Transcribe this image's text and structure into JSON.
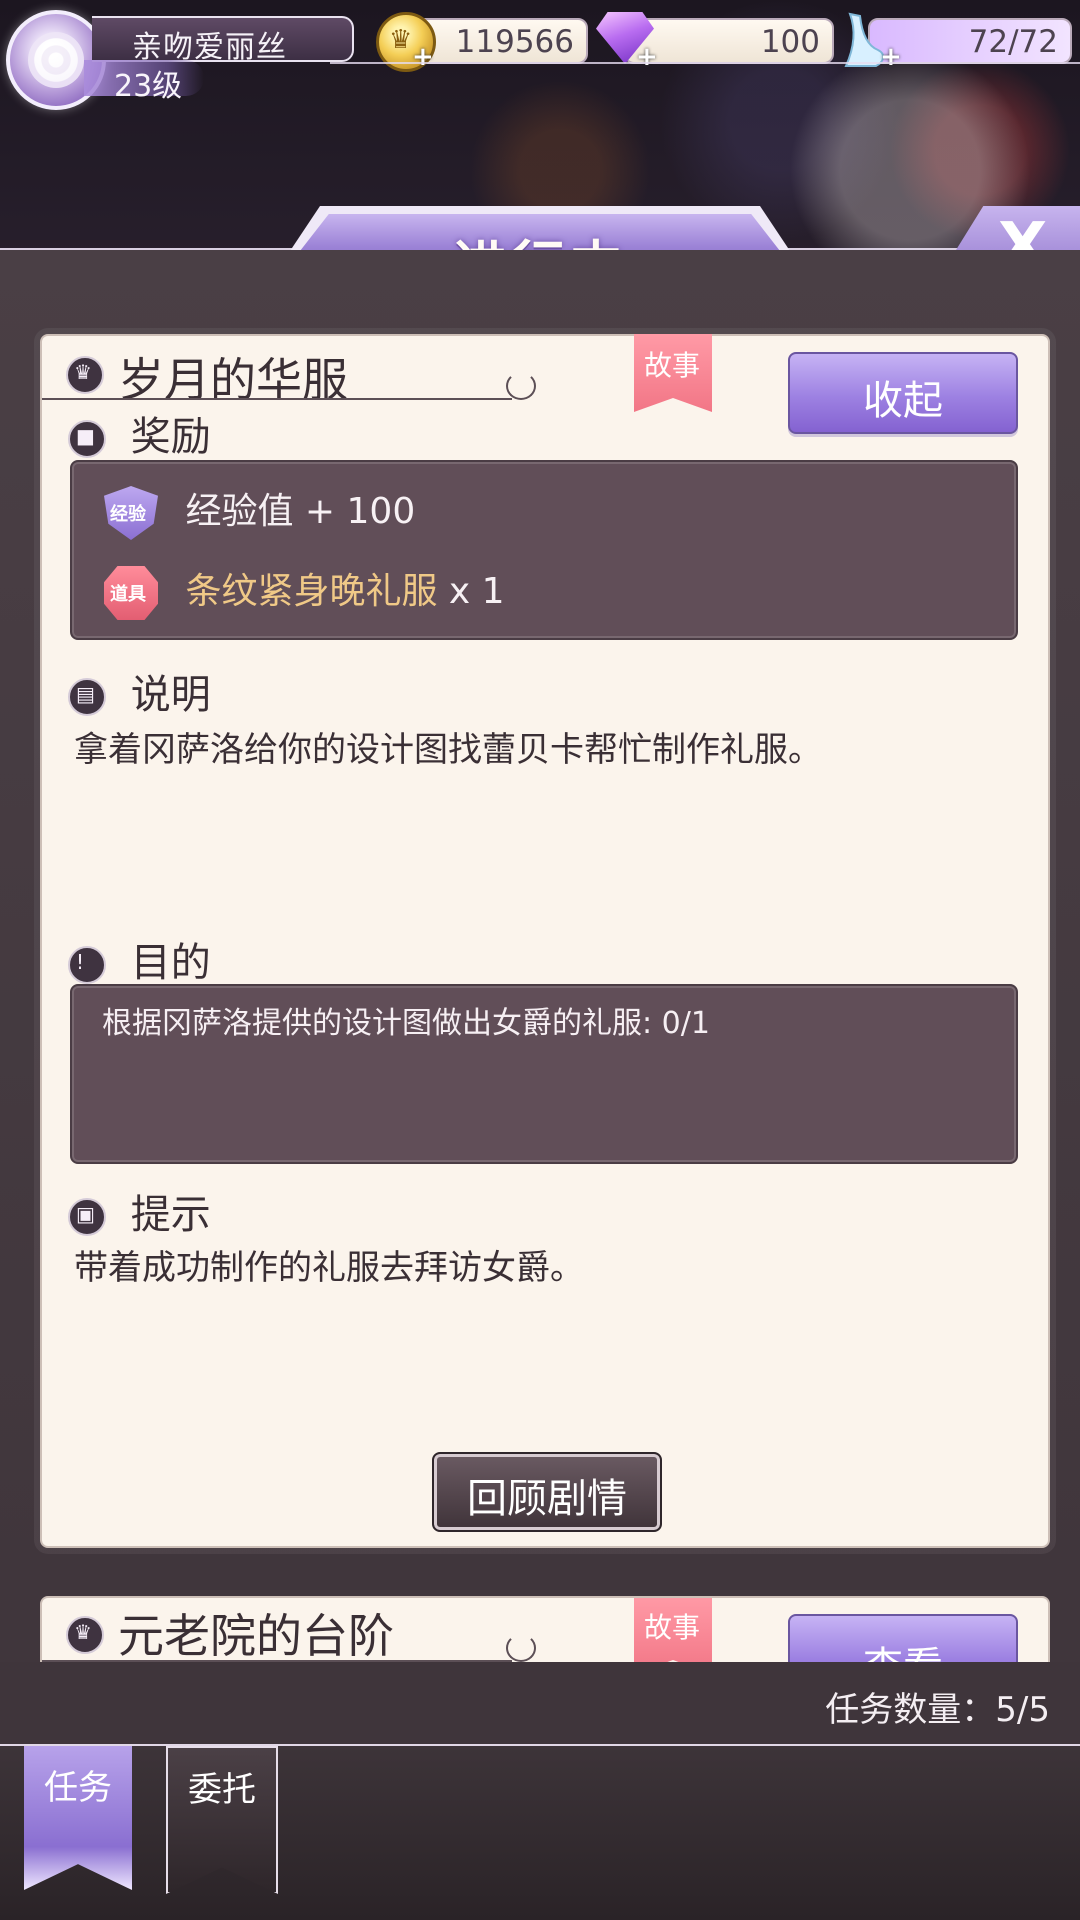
{
  "player": {
    "name": "亲吻爱丽丝",
    "level": "23级"
  },
  "currencies": {
    "gold": "119566",
    "diamond": "100",
    "stamina": "72/72"
  },
  "header": {
    "title": "进行中",
    "close": "X"
  },
  "task": {
    "title": "岁月的华服",
    "ribbon": "故事",
    "collapse_button": "收起",
    "reward_heading": "奖励",
    "rewards": [
      {
        "badge": "经验",
        "text": "经验值 + 100"
      },
      {
        "badge": "道具",
        "name": "条纹紧身晚礼服",
        "qty": " x 1"
      }
    ],
    "description_heading": "说明",
    "description": "拿着冈萨洛给你的设计图找蕾贝卡帮忙制作礼服。",
    "goal_heading": "目的",
    "goal": "根据冈萨洛提供的设计图做出女爵的礼服: 0/1",
    "hint_heading": "提示",
    "hint": "带着成功制作的礼服去拜访女爵。",
    "review_button": "回顾剧情"
  },
  "next_task": {
    "title": "元老院的台阶",
    "ribbon": "故事",
    "view_button": "查看"
  },
  "task_count": "任务数量：5/5",
  "tabs": [
    {
      "label": "任务",
      "active": true
    },
    {
      "label": "委托",
      "active": false
    }
  ],
  "colors": {
    "accent": "#9b82d6",
    "card_bg": "#fbf4ec",
    "dark_box": "#614e58",
    "ribbon": "#f27686",
    "item_gold": "#f0c987"
  }
}
